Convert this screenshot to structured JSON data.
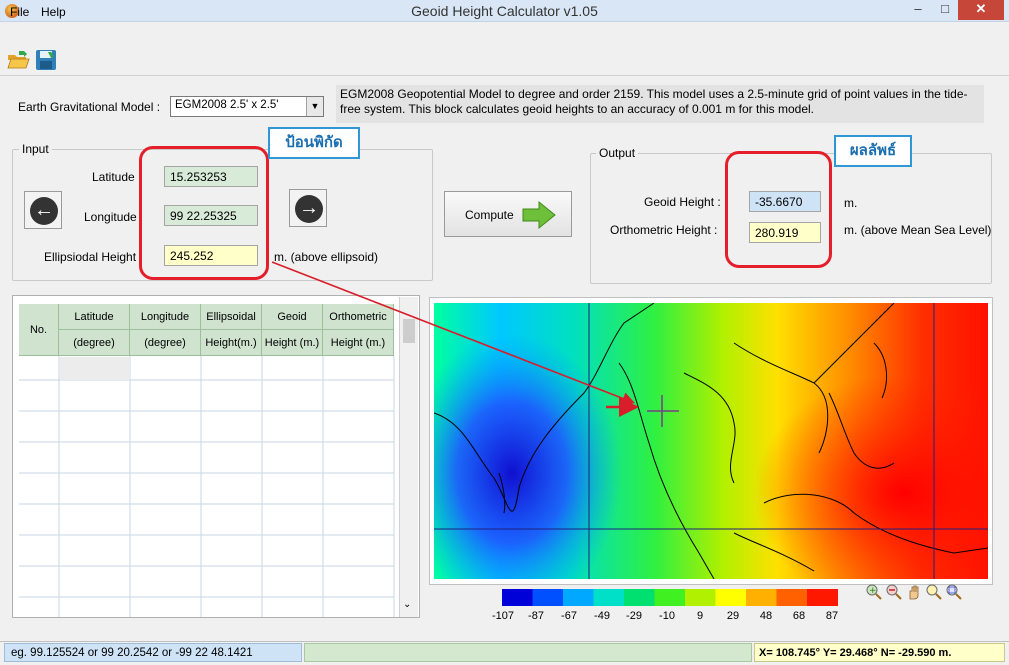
{
  "window": {
    "title": "Geoid Height Calculator v1.05",
    "minimize": "–",
    "maximize": "□",
    "close": "✕"
  },
  "menu": {
    "file": "File",
    "help": "Help"
  },
  "toolbar": {
    "open_icon": "folder-open-icon",
    "save_icon": "save-disk-icon"
  },
  "model": {
    "label": "Earth Gravitational Model :",
    "selected": "EGM2008 2.5' x 2.5'",
    "description": "EGM2008 Geopotential Model to degree and order 2159. This model uses a 2.5-minute grid of point values in the tide-free system. This block calculates geoid heights to an accuracy of 0.001 m for this model."
  },
  "input": {
    "group_label": "Input",
    "annotation": "ป้อนพิกัด",
    "latitude_label": "Latitude",
    "latitude_value": "15.253253",
    "longitude_label": "Longitude",
    "longitude_value": "99 22.25325",
    "ellipsoidal_label": "Ellipsiodal Height",
    "ellipsoidal_value": "245.252",
    "ellipsoidal_unit": "m. (above ellipsoid)"
  },
  "compute": {
    "label": "Compute"
  },
  "output": {
    "group_label": "Output",
    "annotation": "ผลลัพธ์",
    "geoid_label": "Geoid Height :",
    "geoid_value": "-35.6670",
    "geoid_unit": "m.",
    "ortho_label": "Orthometric Height :",
    "ortho_value": "280.919",
    "ortho_unit": "m. (above Mean Sea Level)"
  },
  "table": {
    "headers_top": [
      "No.",
      "Latitude",
      "Longitude",
      "Ellipsoidal",
      "Geoid",
      "Orthometric"
    ],
    "headers_bottom": [
      "(degree)",
      "(degree)",
      "Height(m.)",
      "Height (m.)",
      "Height (m.)"
    ]
  },
  "colorbar": {
    "labels": [
      "-107",
      "-87",
      "-67",
      "-49",
      "-29",
      "-10",
      "9",
      "29",
      "48",
      "68",
      "87"
    ],
    "colors": [
      "#0000d8",
      "#0050ff",
      "#00a8ff",
      "#00e0c8",
      "#00e070",
      "#40f020",
      "#b0f000",
      "#ffff00",
      "#ffb000",
      "#ff6000",
      "#ff1800"
    ]
  },
  "tools": [
    "zoom-in-icon",
    "zoom-out-icon",
    "pan-hand-icon",
    "zoom-fit-icon",
    "zoom-window-icon"
  ],
  "status": {
    "hint": "eg. 99.125524 or 99 20.2542 or -99 22 48.1421",
    "cursor": "X= 108.745°  Y= 29.468°  N= -29.590 m."
  }
}
